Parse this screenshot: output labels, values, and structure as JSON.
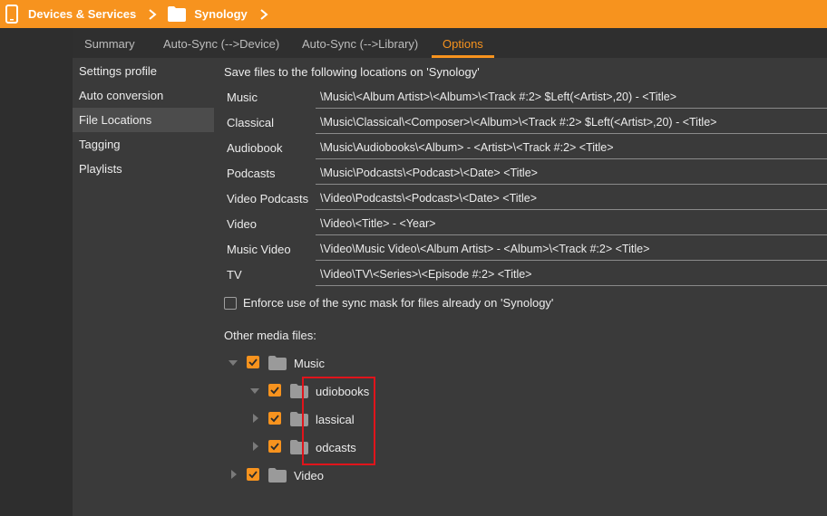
{
  "breadcrumb": {
    "item1": "Devices & Services",
    "item2": "Synology"
  },
  "tabs": [
    {
      "label": "Summary",
      "active": false
    },
    {
      "label": "Auto-Sync (-->Device)",
      "active": false
    },
    {
      "label": "Auto-Sync (-->Library)",
      "active": false
    },
    {
      "label": "Options",
      "active": true
    }
  ],
  "sidebar": {
    "items": [
      {
        "label": "Settings profile",
        "selected": false
      },
      {
        "label": "Auto conversion",
        "selected": false
      },
      {
        "label": "File Locations",
        "selected": true
      },
      {
        "label": "Tagging",
        "selected": false
      },
      {
        "label": "Playlists",
        "selected": false
      }
    ]
  },
  "main": {
    "heading": "Save files to the following locations on 'Synology'",
    "locations": [
      {
        "label": "Music",
        "value": "\\Music\\<Album Artist>\\<Album>\\<Track #:2> $Left(<Artist>,20) - <Title>"
      },
      {
        "label": "Classical",
        "value": "\\Music\\Classical\\<Composer>\\<Album>\\<Track #:2> $Left(<Artist>,20) - <Title>"
      },
      {
        "label": "Audiobook",
        "value": "\\Music\\Audiobooks\\<Album> - <Artist>\\<Track #:2> <Title>"
      },
      {
        "label": "Podcasts",
        "value": "\\Music\\Podcasts\\<Podcast>\\<Date> <Title>"
      },
      {
        "label": "Video Podcasts",
        "value": "\\Video\\Podcasts\\<Podcast>\\<Date> <Title>"
      },
      {
        "label": "Video",
        "value": "\\Video\\<Title> - <Year>"
      },
      {
        "label": "Music Video",
        "value": "\\Video\\Music Video\\<Album Artist> - <Album>\\<Track #:2> <Title>"
      },
      {
        "label": "TV",
        "value": "\\Video\\TV\\<Series>\\<Episode #:2> <Title>"
      }
    ],
    "enforce": {
      "label": "Enforce use of the sync mask for files already on 'Synology'",
      "checked": false
    },
    "other_label": "Other media files:",
    "tree": [
      {
        "label": "Music",
        "checked": true,
        "expanded": true,
        "level": 0
      },
      {
        "label": "udiobooks",
        "checked": true,
        "expanded": true,
        "level": 1
      },
      {
        "label": "lassical",
        "checked": true,
        "expanded": false,
        "level": 1
      },
      {
        "label": "odcasts",
        "checked": true,
        "expanded": false,
        "level": 1
      },
      {
        "label": "Video",
        "checked": true,
        "expanded": false,
        "level": 0
      }
    ]
  },
  "colors": {
    "accent": "#f7931e",
    "highlight_box": "#e0141b"
  }
}
